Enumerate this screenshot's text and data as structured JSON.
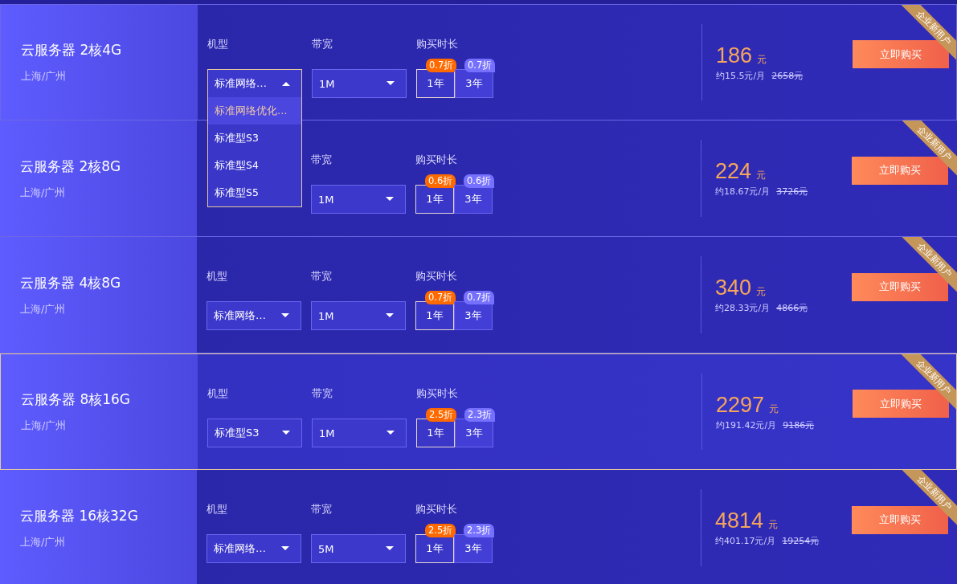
{
  "plans": [
    {
      "name": "云服务器 2核4G",
      "region": "上海/广州",
      "ribbon": "企业新用户",
      "highlighted": false,
      "model": {
        "label": "机型",
        "value": "标准网络…",
        "expanded": true,
        "options": [
          {
            "label": "标准网络优化…",
            "selected": true
          },
          {
            "label": "标准型S3",
            "selected": false
          },
          {
            "label": "标准型S4",
            "selected": false
          },
          {
            "label": "标准型S5",
            "selected": false
          }
        ]
      },
      "bandwidth": {
        "label": "带宽",
        "value": "1M"
      },
      "duration": {
        "label": "购买时长",
        "options": [
          {
            "label": "1年",
            "badge": "0.7折",
            "selected": true
          },
          {
            "label": "3年",
            "badge": "0.7折",
            "selected": false
          }
        ]
      },
      "price": "186",
      "unit": "元",
      "monthly": "约15.5元/月",
      "original": "2658元",
      "buy": "立即购买"
    },
    {
      "name": "云服务器 2核8G",
      "region": "上海/广州",
      "ribbon": "企业新用户",
      "highlighted": false,
      "bandwidth": {
        "label": "带宽",
        "value": "1M"
      },
      "duration": {
        "label": "购买时长",
        "options": [
          {
            "label": "1年",
            "badge": "0.6折",
            "selected": true
          },
          {
            "label": "3年",
            "badge": "0.6折",
            "selected": false
          }
        ]
      },
      "price": "224",
      "unit": "元",
      "monthly": "约18.67元/月",
      "original": "3726元",
      "buy": "立即购买"
    },
    {
      "name": "云服务器 4核8G",
      "region": "上海/广州",
      "ribbon": "企业新用户",
      "highlighted": false,
      "model": {
        "label": "机型",
        "value": "标准网络…",
        "expanded": false
      },
      "bandwidth": {
        "label": "带宽",
        "value": "1M"
      },
      "duration": {
        "label": "购买时长",
        "options": [
          {
            "label": "1年",
            "badge": "0.7折",
            "selected": true
          },
          {
            "label": "3年",
            "badge": "0.7折",
            "selected": false
          }
        ]
      },
      "price": "340",
      "unit": "元",
      "monthly": "约28.33元/月",
      "original": "4866元",
      "buy": "立即购买"
    },
    {
      "name": "云服务器 8核16G",
      "region": "上海/广州",
      "ribbon": "企业新用户",
      "highlighted": true,
      "model": {
        "label": "机型",
        "value": "标准型S3",
        "expanded": false
      },
      "bandwidth": {
        "label": "带宽",
        "value": "1M"
      },
      "duration": {
        "label": "购买时长",
        "options": [
          {
            "label": "1年",
            "badge": "2.5折",
            "selected": true
          },
          {
            "label": "3年",
            "badge": "2.3折",
            "selected": false
          }
        ]
      },
      "price": "2297",
      "unit": "元",
      "monthly": "约191.42元/月",
      "original": "9186元",
      "buy": "立即购买"
    },
    {
      "name": "云服务器 16核32G",
      "region": "上海/广州",
      "ribbon": "企业新用户",
      "highlighted": false,
      "model": {
        "label": "机型",
        "value": "标准网络…",
        "expanded": false
      },
      "bandwidth": {
        "label": "带宽",
        "value": "5M"
      },
      "duration": {
        "label": "购买时长",
        "options": [
          {
            "label": "1年",
            "badge": "2.5折",
            "selected": true
          },
          {
            "label": "3年",
            "badge": "2.3折",
            "selected": false
          }
        ]
      },
      "price": "4814",
      "unit": "元",
      "monthly": "约401.17元/月",
      "original": "19254元",
      "buy": "立即购买"
    }
  ]
}
